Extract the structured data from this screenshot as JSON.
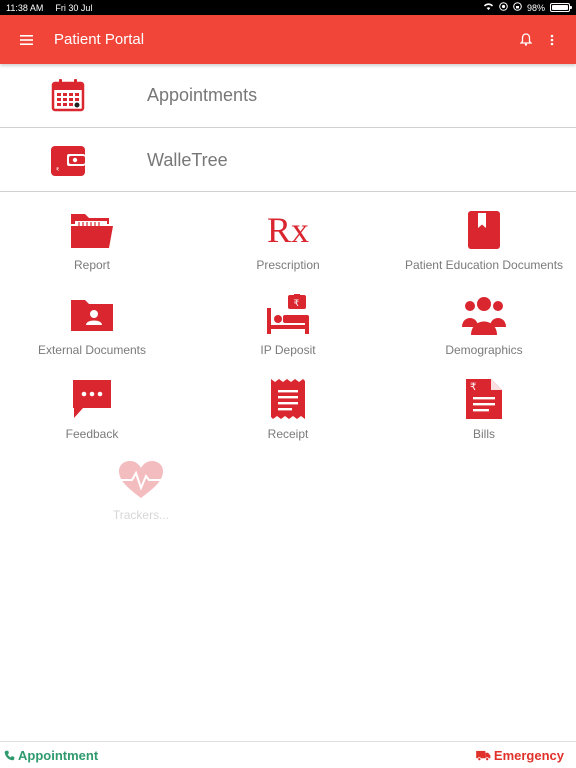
{
  "status_bar": {
    "time": "11:38 AM",
    "date": "Fri 30 Jul",
    "battery": "98%",
    "battery_level": 0.98
  },
  "app_bar": {
    "title": "Patient Portal"
  },
  "rows": [
    {
      "label": "Appointments",
      "icon": "calendar-icon"
    },
    {
      "label": "WalleTree",
      "icon": "wallet-icon"
    }
  ],
  "tiles": [
    {
      "label": "Report",
      "icon": "folder-report-icon"
    },
    {
      "label": "Prescription",
      "icon": "rx-icon",
      "glyph": "Rx"
    },
    {
      "label": "Patient Education Documents",
      "icon": "book-icon"
    },
    {
      "label": "External Documents",
      "icon": "contact-folder-icon"
    },
    {
      "label": "IP Deposit",
      "icon": "hospital-bed-icon"
    },
    {
      "label": "Demographics",
      "icon": "people-group-icon"
    },
    {
      "label": "Feedback",
      "icon": "chat-bubble-icon"
    },
    {
      "label": "Receipt",
      "icon": "receipt-icon"
    },
    {
      "label": "Bills",
      "icon": "bill-document-icon"
    },
    {
      "label": "Trackers...",
      "icon": "heart-pulse-icon"
    }
  ],
  "bottom_bar": {
    "appointment": "Appointment",
    "emergency": "Emergency"
  },
  "colors": {
    "primary": "#f04538",
    "icon_red": "#d9262f",
    "appointment_green": "#2e9a6e",
    "emergency_red": "#e0322b"
  }
}
